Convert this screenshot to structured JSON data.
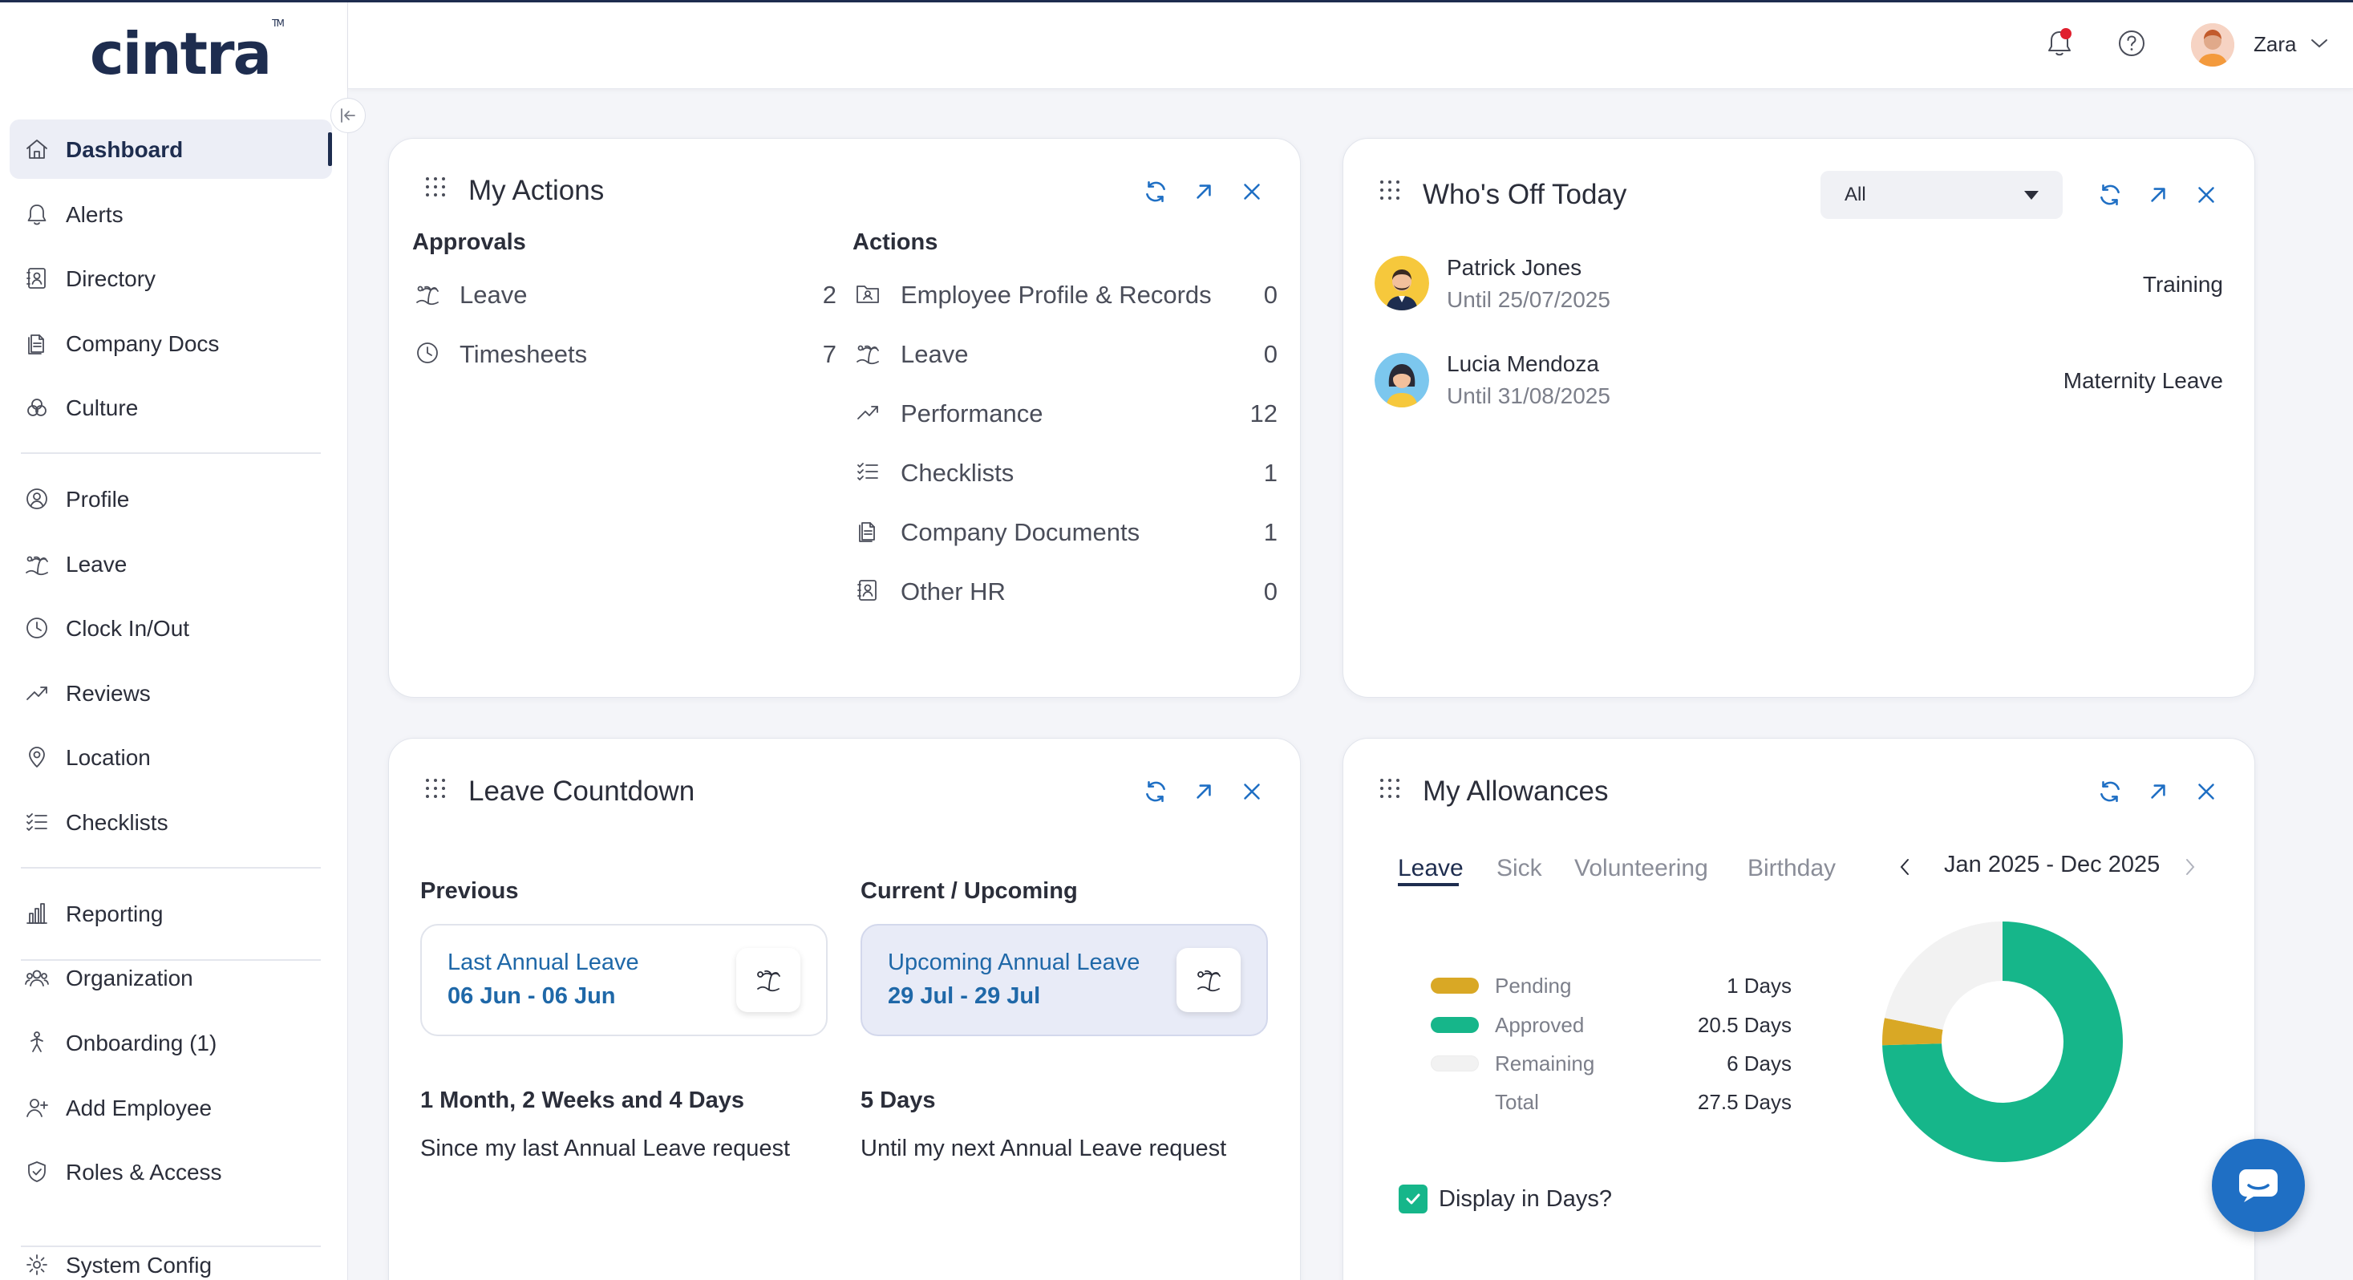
{
  "app": {
    "brand": "cintra",
    "trademark": "TM"
  },
  "header": {
    "username": "Zara",
    "notification_color": "#e0202e"
  },
  "sidebar": {
    "items": [
      {
        "label": "Dashboard",
        "icon": "home-icon",
        "active": true
      },
      {
        "label": "Alerts",
        "icon": "bell-icon"
      },
      {
        "label": "Directory",
        "icon": "contact-book-icon"
      },
      {
        "label": "Company Docs",
        "icon": "documents-icon"
      },
      {
        "label": "Culture",
        "icon": "culture-icon"
      },
      {
        "label": "Profile",
        "icon": "user-circle-icon"
      },
      {
        "label": "Leave",
        "icon": "island-icon"
      },
      {
        "label": "Clock In/Out",
        "icon": "clock-icon"
      },
      {
        "label": "Reviews",
        "icon": "trend-icon"
      },
      {
        "label": "Location",
        "icon": "pin-icon"
      },
      {
        "label": "Checklists",
        "icon": "checklist-icon"
      },
      {
        "label": "Reporting",
        "icon": "bar-chart-icon"
      },
      {
        "label": "Organization",
        "icon": "team-icon"
      },
      {
        "label": "Onboarding (1)",
        "icon": "onboarding-icon"
      },
      {
        "label": "Add Employee",
        "icon": "user-plus-icon"
      },
      {
        "label": "Roles & Access",
        "icon": "shield-icon"
      },
      {
        "label": "System Config",
        "icon": "gear-icon"
      }
    ]
  },
  "my_actions": {
    "title": "My Actions",
    "approvals_heading": "Approvals",
    "actions_heading": "Actions",
    "approvals": [
      {
        "label": "Leave",
        "count": "2",
        "icon": "island-icon"
      },
      {
        "label": "Timesheets",
        "count": "7",
        "icon": "clock-icon"
      }
    ],
    "actions": [
      {
        "label": "Employee Profile & Records",
        "count": "0",
        "icon": "profile-records-icon"
      },
      {
        "label": "Leave",
        "count": "0",
        "icon": "island-icon"
      },
      {
        "label": "Performance",
        "count": "12",
        "icon": "trend-icon"
      },
      {
        "label": "Checklists",
        "count": "1",
        "icon": "checklist-icon"
      },
      {
        "label": "Company Documents",
        "count": "1",
        "icon": "documents-icon"
      },
      {
        "label": "Other HR",
        "count": "0",
        "icon": "contact-book-icon"
      }
    ]
  },
  "whos_off": {
    "title": "Who's Off Today",
    "filter": "All",
    "people": [
      {
        "name": "Patrick Jones",
        "until": "Until 25/07/2025",
        "type": "Training",
        "avatar_bg": "#f6c83c"
      },
      {
        "name": "Lucia Mendoza",
        "until": "Until 31/08/2025",
        "type": "Maternity Leave",
        "avatar_bg": "#7cc7ee"
      }
    ]
  },
  "leave_countdown": {
    "title": "Leave Countdown",
    "previous": {
      "heading": "Previous",
      "box_title": "Last Annual Leave",
      "dates": "06 Jun - 06 Jun",
      "duration": "1 Month, 2 Weeks and 4 Days",
      "caption": "Since my last Annual Leave request"
    },
    "upcoming": {
      "heading": "Current / Upcoming",
      "box_title": "Upcoming Annual Leave",
      "dates": "29 Jul - 29 Jul",
      "duration": "5 Days",
      "caption": "Until my next Annual Leave request"
    }
  },
  "allowances": {
    "title": "My Allowances",
    "tabs": [
      "Leave",
      "Sick",
      "Volunteering",
      "Birthday"
    ],
    "active_tab": "Leave",
    "period": "Jan 2025 - Dec 2025",
    "legend": [
      {
        "label": "Pending",
        "value": "1 Days",
        "color": "#d9a825"
      },
      {
        "label": "Approved",
        "value": "20.5 Days",
        "color": "#16b68a"
      },
      {
        "label": "Remaining",
        "value": "6 Days",
        "color": "#f2f2f2"
      },
      {
        "label": "Total",
        "value": "27.5 Days",
        "color": ""
      }
    ],
    "checkbox_label": "Display in Days?",
    "checkbox_checked": true
  },
  "chart_data": {
    "type": "pie",
    "categories": [
      "Approved",
      "Pending",
      "Remaining"
    ],
    "values": [
      20.5,
      1,
      6
    ],
    "colors": [
      "#16b68a",
      "#d9a825",
      "#f2f2f2"
    ]
  },
  "colors": {
    "brand": "#1e2d4f",
    "accent_blue": "#1f68a8",
    "tool_blue": "#1f6fc4",
    "green": "#16b68a",
    "gold": "#d9a825"
  }
}
